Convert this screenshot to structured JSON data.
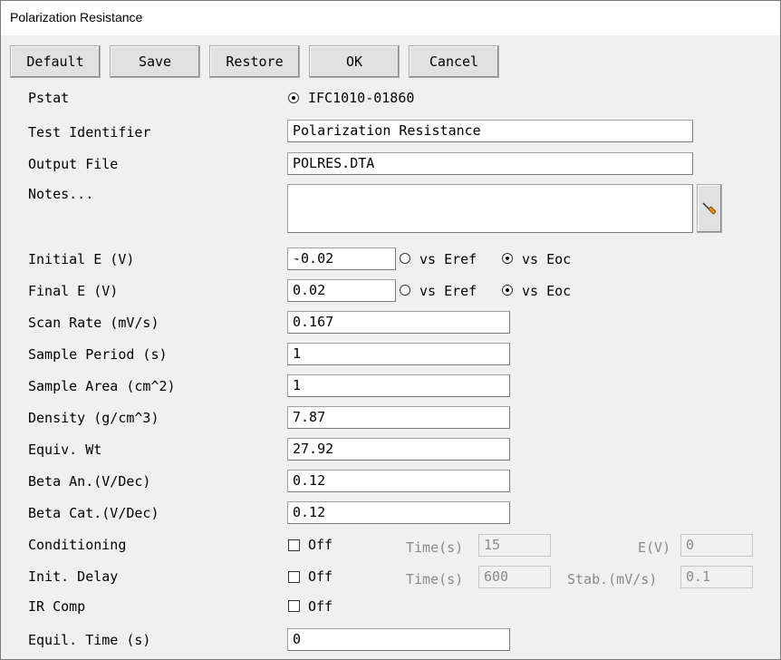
{
  "window": {
    "title": "Polarization Resistance"
  },
  "toolbar": {
    "default_label": "Default",
    "save_label": "Save",
    "restore_label": "Restore",
    "ok_label": "OK",
    "cancel_label": "Cancel"
  },
  "pstat": {
    "label": "Pstat",
    "value": "IFC1010-01860"
  },
  "test_identifier": {
    "label": "Test Identifier",
    "value": "Polarization Resistance"
  },
  "output_file": {
    "label": "Output File",
    "value": "POLRES.DTA"
  },
  "notes": {
    "label": "Notes...",
    "value": "",
    "edit_icon": "screwdriver-icon"
  },
  "initial_e": {
    "label": "Initial E (V)",
    "value": "-0.02",
    "vs_eref": "vs Eref",
    "vs_eoc": "vs Eoc",
    "selected": "vs Eoc"
  },
  "final_e": {
    "label": "Final E (V)",
    "value": "0.02",
    "vs_eref": "vs Eref",
    "vs_eoc": "vs Eoc",
    "selected": "vs Eoc"
  },
  "scan_rate": {
    "label": "Scan Rate (mV/s)",
    "value": "0.167"
  },
  "sample_period": {
    "label": "Sample Period (s)",
    "value": "1"
  },
  "sample_area": {
    "label": "Sample Area (cm^2)",
    "value": "1"
  },
  "density": {
    "label": "Density (g/cm^3)",
    "value": "7.87"
  },
  "equiv_wt": {
    "label": "Equiv. Wt",
    "value": "27.92"
  },
  "beta_an": {
    "label": "Beta An.(V/Dec)",
    "value": "0.12"
  },
  "beta_cat": {
    "label": "Beta Cat.(V/Dec)",
    "value": "0.12"
  },
  "conditioning": {
    "label": "Conditioning",
    "checkbox_label": "Off",
    "checked": false,
    "time_label": "Time(s)",
    "time_value": "15",
    "e_label": "E(V)",
    "e_value": "0"
  },
  "init_delay": {
    "label": "Init. Delay",
    "checkbox_label": "Off",
    "checked": false,
    "time_label": "Time(s)",
    "time_value": "600",
    "stab_label": "Stab.(mV/s)",
    "stab_value": "0.1"
  },
  "ir_comp": {
    "label": "IR Comp",
    "checkbox_label": "Off",
    "checked": false
  },
  "equil_time": {
    "label": "Equil. Time (s)",
    "value": "0"
  }
}
